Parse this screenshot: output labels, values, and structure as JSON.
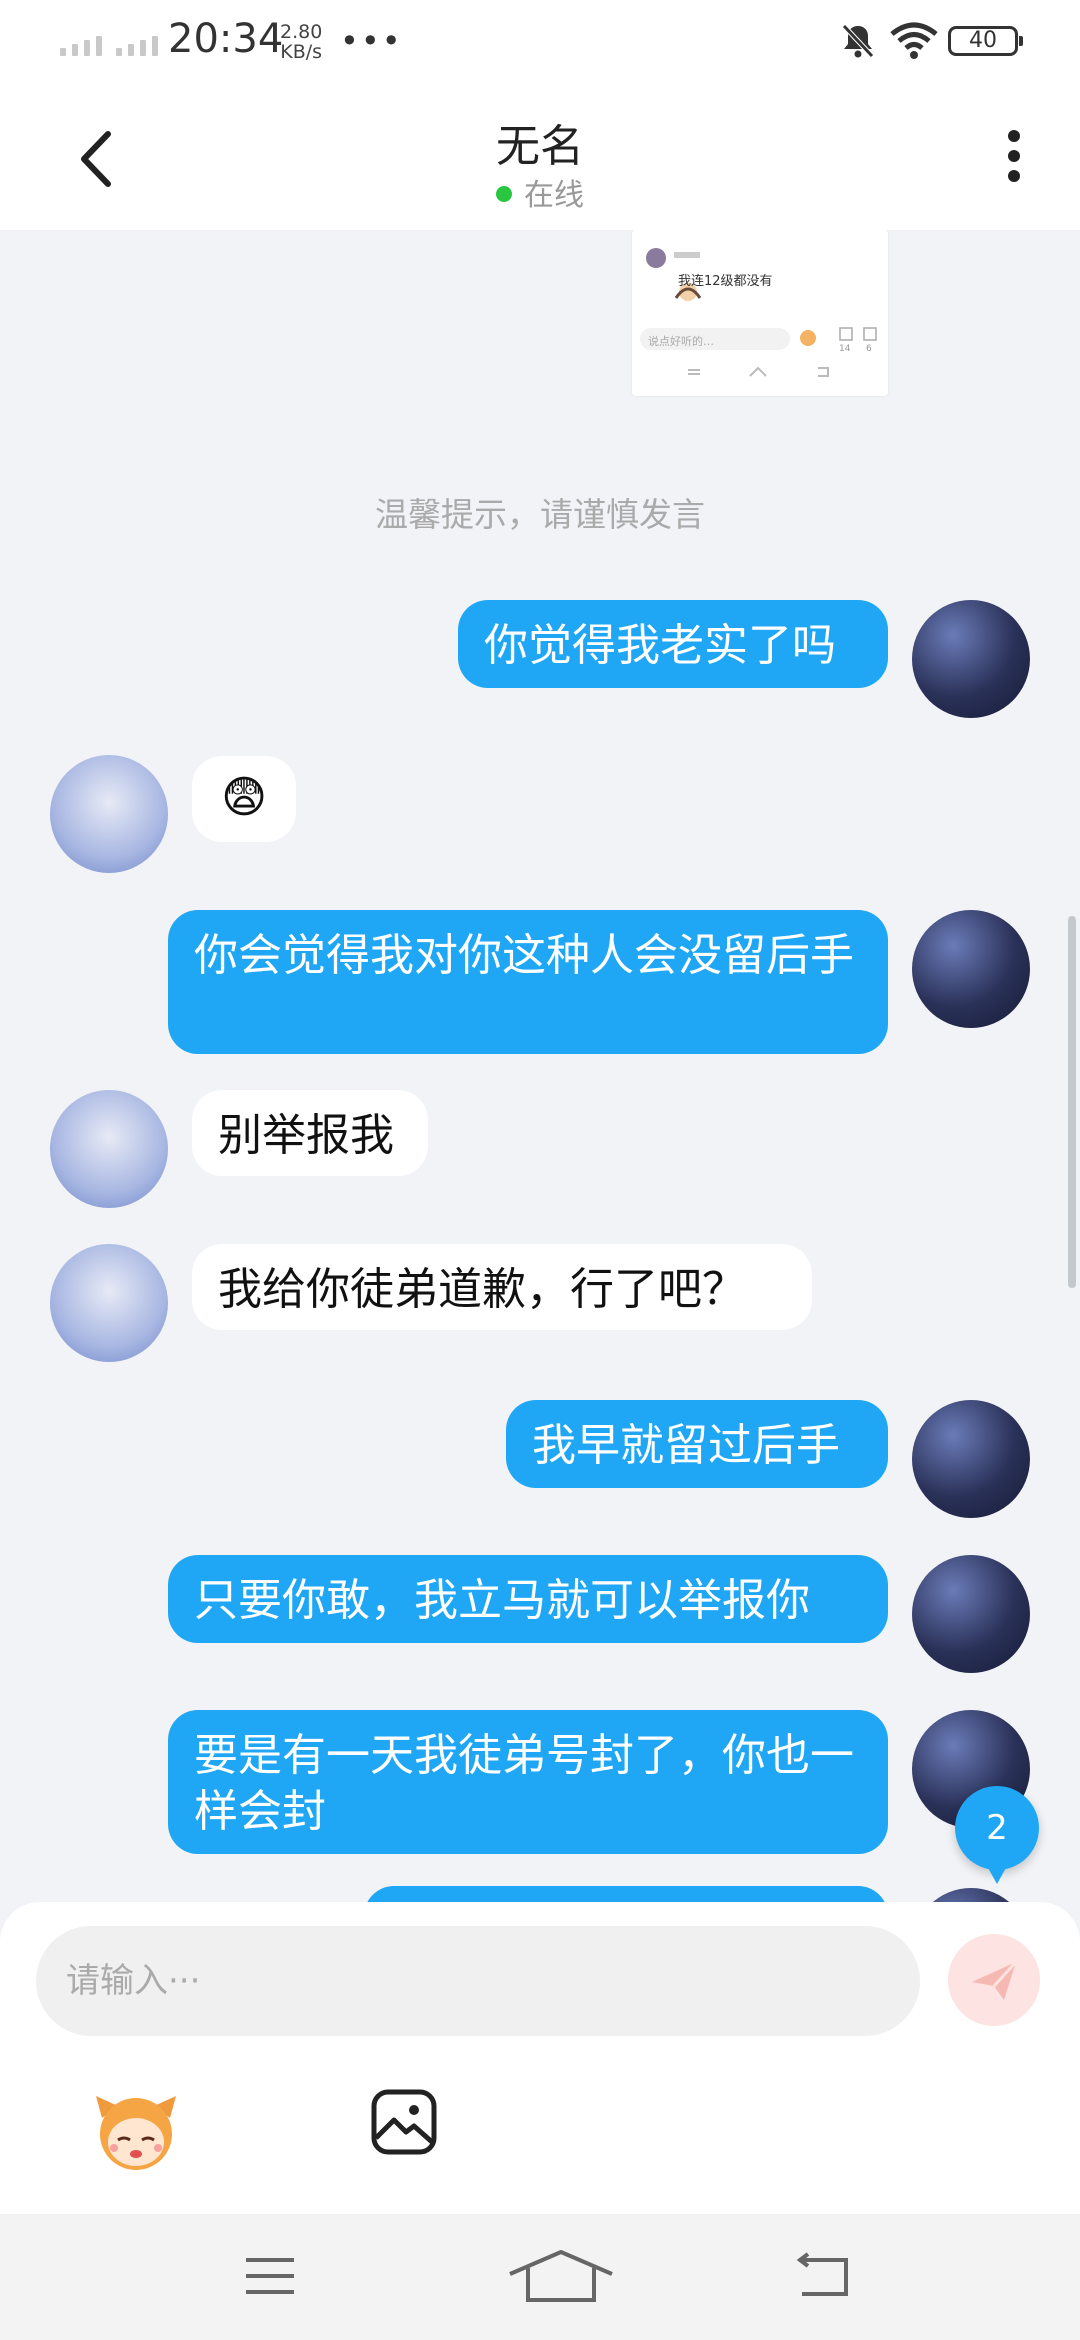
{
  "status_bar": {
    "time": "20:34",
    "speed_value": "2.80",
    "speed_unit": "KB/s",
    "dots": "•••",
    "battery": "40"
  },
  "header": {
    "title": "无名",
    "status": "在线"
  },
  "chat": {
    "shared_screenshot": {
      "caption": "我连12级都没有",
      "comment_placeholder": "说点好听的…",
      "counts": [
        "14",
        "6"
      ]
    },
    "hint": "温馨提示，请谨慎发言",
    "messages": [
      {
        "from": "me",
        "text": "你觉得我老实了吗"
      },
      {
        "from": "them",
        "emoji": "😨"
      },
      {
        "from": "me",
        "text": "你会觉得我对你这种人会没留后手"
      },
      {
        "from": "them",
        "text": "别举报我"
      },
      {
        "from": "them",
        "text": "我给你徒弟道歉，行了吧？"
      },
      {
        "from": "me",
        "text": "我早就留过后手"
      },
      {
        "from": "me",
        "text": "只要你敢，我立马就可以举报你"
      },
      {
        "from": "me",
        "text": "要是有一天我徒弟号封了，你也一样会封"
      }
    ],
    "unread_count": "2"
  },
  "composer": {
    "placeholder": "请输入···",
    "send_color": "#fde3e1"
  },
  "colors": {
    "accent": "#1fa7f5",
    "online": "#29c640"
  }
}
